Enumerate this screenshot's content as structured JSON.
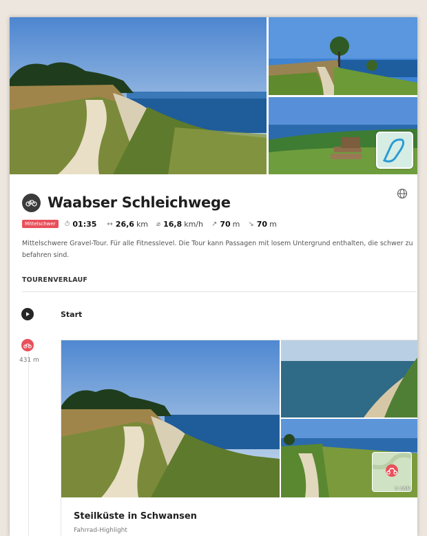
{
  "tour": {
    "title": "Waabser Schleichwege",
    "difficulty": "Mittelschwer",
    "duration": "01:35",
    "distance_value": "26,6",
    "distance_unit": "km",
    "speed_value": "16,8",
    "speed_unit": "km/h",
    "ascent_value": "70",
    "ascent_unit": "m",
    "descent_value": "70",
    "descent_unit": "m",
    "description": "Mittelschwere Gravel-Tour. Für alle Fitnesslevel. Die Tour kann Passagen mit losem Untergrund enthalten, die schwer zu befahren sind."
  },
  "section": {
    "label": "TOURENVERLAUF"
  },
  "timeline": {
    "start_label": "Start",
    "waypoint_distance": "431 m",
    "highlight": {
      "title": "Steilküste in Schwansen",
      "subtitle": "Fahrrad-Highlight",
      "map_credit": "© OSM"
    }
  },
  "icons": {
    "sport": "bicycle-icon",
    "language": "globe-icon",
    "start": "play-icon",
    "highlight": "bicycle-icon"
  },
  "colors": {
    "badge": "#e8505b",
    "accent": "#e8505b"
  }
}
